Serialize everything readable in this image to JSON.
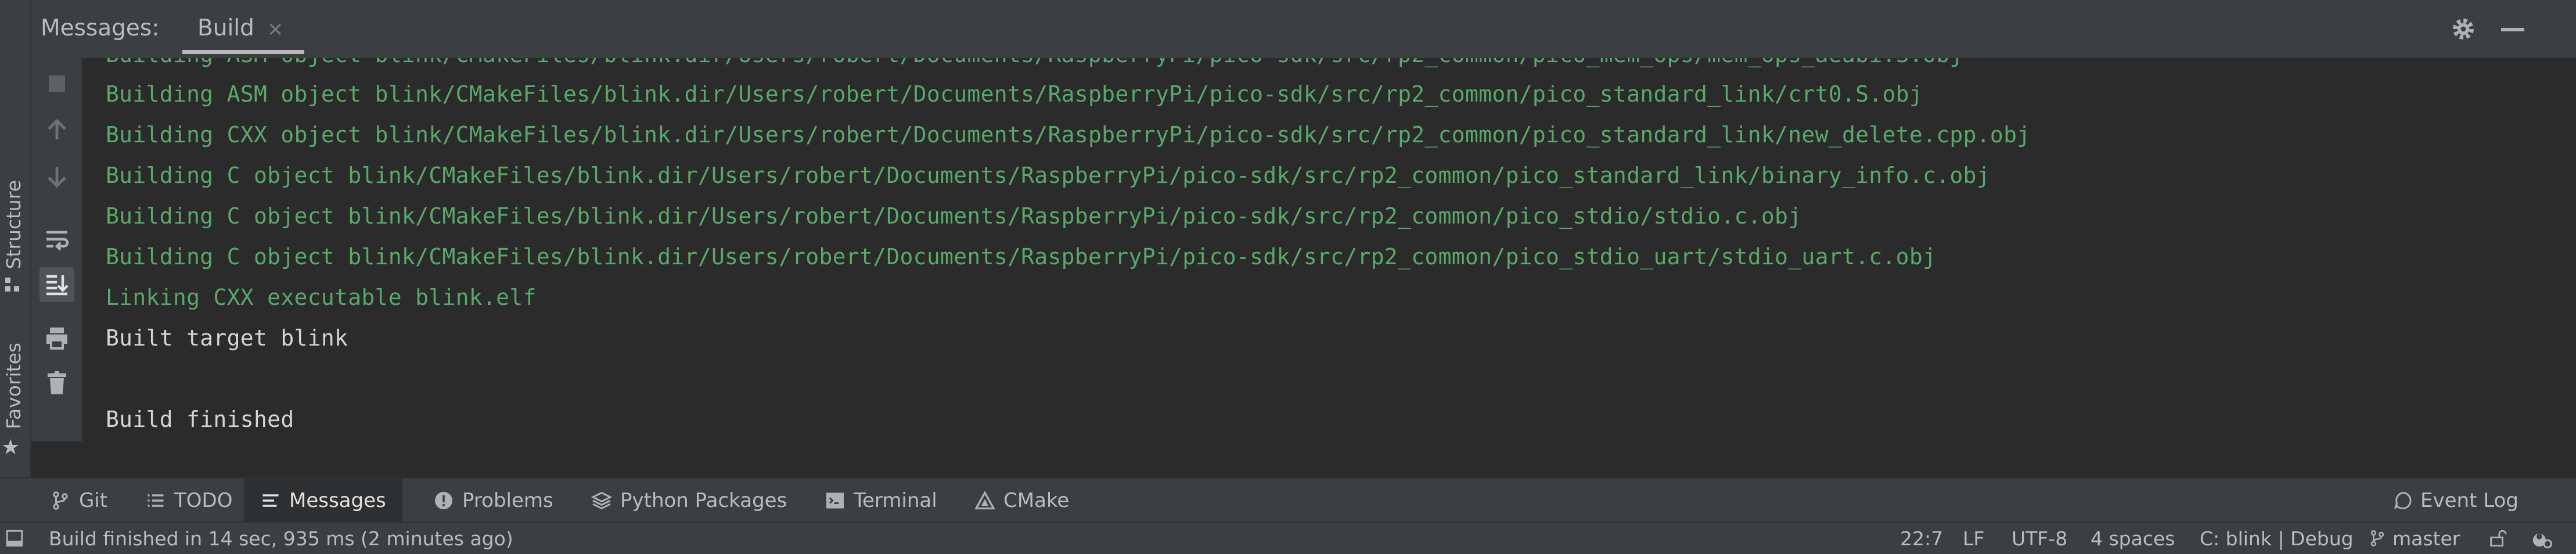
{
  "header": {
    "title": "Messages:",
    "tab_label": "Build",
    "tab_close": "×",
    "gear_icon": "gear-icon",
    "minimize_icon": "minimize-icon"
  },
  "left_strip": {
    "structure_label": "Structure",
    "favorites_label": "Favorites"
  },
  "toolbar": {
    "items": [
      "stop-icon",
      "arrow-up-icon",
      "arrow-down-icon",
      "soft-wrap-icon",
      "scroll-to-end-icon",
      "print-icon",
      "trash-icon"
    ]
  },
  "console": {
    "lines": [
      {
        "text": "Building ASM object blink/CMakeFiles/blink.dir/Users/robert/Documents/RaspberryPi/pico-sdk/src/rp2_common/pico_mem_ops/mem_ops_aeabi.S.obj",
        "color": "#59a869"
      },
      {
        "text": "Building ASM object blink/CMakeFiles/blink.dir/Users/robert/Documents/RaspberryPi/pico-sdk/src/rp2_common/pico_standard_link/crt0.S.obj",
        "color": "#59a869"
      },
      {
        "text": "Building CXX object blink/CMakeFiles/blink.dir/Users/robert/Documents/RaspberryPi/pico-sdk/src/rp2_common/pico_standard_link/new_delete.cpp.obj",
        "color": "#59a869"
      },
      {
        "text": "Building C object blink/CMakeFiles/blink.dir/Users/robert/Documents/RaspberryPi/pico-sdk/src/rp2_common/pico_standard_link/binary_info.c.obj",
        "color": "#59a869"
      },
      {
        "text": "Building C object blink/CMakeFiles/blink.dir/Users/robert/Documents/RaspberryPi/pico-sdk/src/rp2_common/pico_stdio/stdio.c.obj",
        "color": "#59a869"
      },
      {
        "text": "Building C object blink/CMakeFiles/blink.dir/Users/robert/Documents/RaspberryPi/pico-sdk/src/rp2_common/pico_stdio_uart/stdio_uart.c.obj",
        "color": "#59a869"
      },
      {
        "text": "Linking CXX executable blink.elf",
        "color": "#59a869"
      },
      {
        "text": "Built target blink",
        "color": "#d4d4d4"
      },
      {
        "text": "",
        "color": "#d4d4d4"
      },
      {
        "text": "Build finished",
        "color": "#d4d4d4"
      }
    ]
  },
  "bottom_tabs": {
    "git": "Git",
    "todo": "TODO",
    "messages": "Messages",
    "problems": "Problems",
    "python_packages": "Python Packages",
    "terminal": "Terminal",
    "cmake": "CMake",
    "event_log": "Event Log"
  },
  "status_bar": {
    "message": "Build finished in 14 sec, 935 ms (2 minutes ago)",
    "position": "22:7",
    "line_separator": "LF",
    "encoding": "UTF-8",
    "indent": "4 spaces",
    "config": "C: blink | Debug",
    "branch": "master"
  },
  "colors": {
    "accent_green": "#59a869",
    "panel": "#3c3f41",
    "console_bg": "#2b2b2b"
  }
}
